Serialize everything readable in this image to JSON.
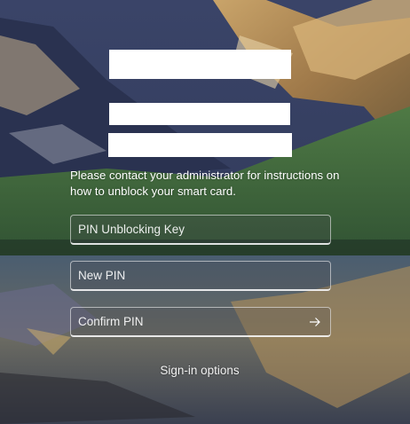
{
  "redacted_blocks": [
    "",
    "",
    ""
  ],
  "message": "Please contact your administrator for instructions on how to unblock your smart card.",
  "fields": {
    "puk": {
      "placeholder": "PIN Unblocking Key",
      "value": ""
    },
    "new_pin": {
      "placeholder": "New PIN",
      "value": ""
    },
    "confirm_pin": {
      "placeholder": "Confirm PIN",
      "value": "",
      "submit_icon": "arrow-right-icon"
    }
  },
  "sign_in_options": "Sign-in options",
  "colors": {
    "text": "#ffffff",
    "field_border": "#ffffff",
    "sky": "#2f3c5a",
    "meadow": "#3f6b3e",
    "lake": "#3a4a5a"
  }
}
